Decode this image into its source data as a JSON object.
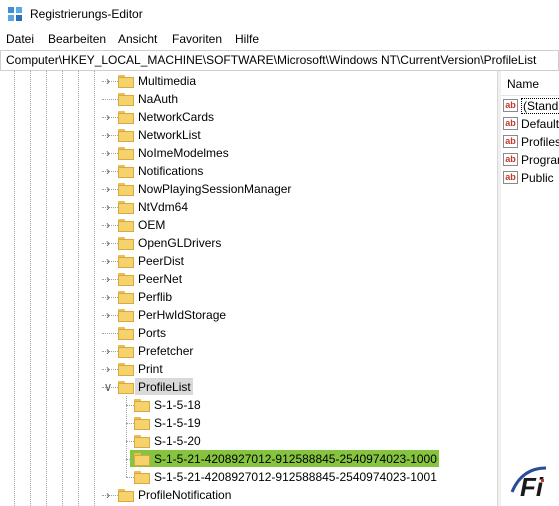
{
  "window": {
    "title": "Registrierungs-Editor",
    "app_icon": "regedit-icon"
  },
  "menu": [
    "Datei",
    "Bearbeiten",
    "Ansicht",
    "Favoriten",
    "Hilfe"
  ],
  "address": "Computer\\HKEY_LOCAL_MACHINE\\SOFTWARE\\Microsoft\\Windows NT\\CurrentVersion\\ProfileList",
  "tree": {
    "items": [
      {
        "label": "Multimedia",
        "expander": "collapsed"
      },
      {
        "label": "NaAuth",
        "expander": "none"
      },
      {
        "label": "NetworkCards",
        "expander": "collapsed"
      },
      {
        "label": "NetworkList",
        "expander": "collapsed"
      },
      {
        "label": "NoImeModelmes",
        "expander": "collapsed"
      },
      {
        "label": "Notifications",
        "expander": "collapsed"
      },
      {
        "label": "NowPlayingSessionManager",
        "expander": "collapsed"
      },
      {
        "label": "NtVdm64",
        "expander": "collapsed"
      },
      {
        "label": "OEM",
        "expander": "collapsed"
      },
      {
        "label": "OpenGLDrivers",
        "expander": "collapsed"
      },
      {
        "label": "PeerDist",
        "expander": "collapsed"
      },
      {
        "label": "PeerNet",
        "expander": "collapsed"
      },
      {
        "label": "Perflib",
        "expander": "collapsed"
      },
      {
        "label": "PerHwIdStorage",
        "expander": "collapsed"
      },
      {
        "label": "Ports",
        "expander": "none"
      },
      {
        "label": "Prefetcher",
        "expander": "collapsed"
      },
      {
        "label": "Print",
        "expander": "collapsed"
      },
      {
        "label": "ProfileList",
        "expander": "expanded",
        "state": "selected-parent"
      },
      {
        "label": "S-1-5-18",
        "expander": "none",
        "child": true
      },
      {
        "label": "S-1-5-19",
        "expander": "none",
        "child": true
      },
      {
        "label": "S-1-5-20",
        "expander": "none",
        "child": true
      },
      {
        "label": "S-1-5-21-4208927012-912588845-2540974023-1000",
        "expander": "none",
        "child": true,
        "state": "highlighted"
      },
      {
        "label": "S-1-5-21-4208927012-912588845-2540974023-1001",
        "expander": "none",
        "child": true
      },
      {
        "label": "ProfileNotification",
        "expander": "collapsed"
      }
    ]
  },
  "list": {
    "column_name": "Name",
    "values": [
      "(Standa",
      "Default",
      "Profiles",
      "Progran",
      "Public"
    ]
  },
  "colors": {
    "highlight": "#86c440",
    "selection_parent": "#d9d9d9",
    "folder": "#f5d26b"
  },
  "watermark": "Fi"
}
